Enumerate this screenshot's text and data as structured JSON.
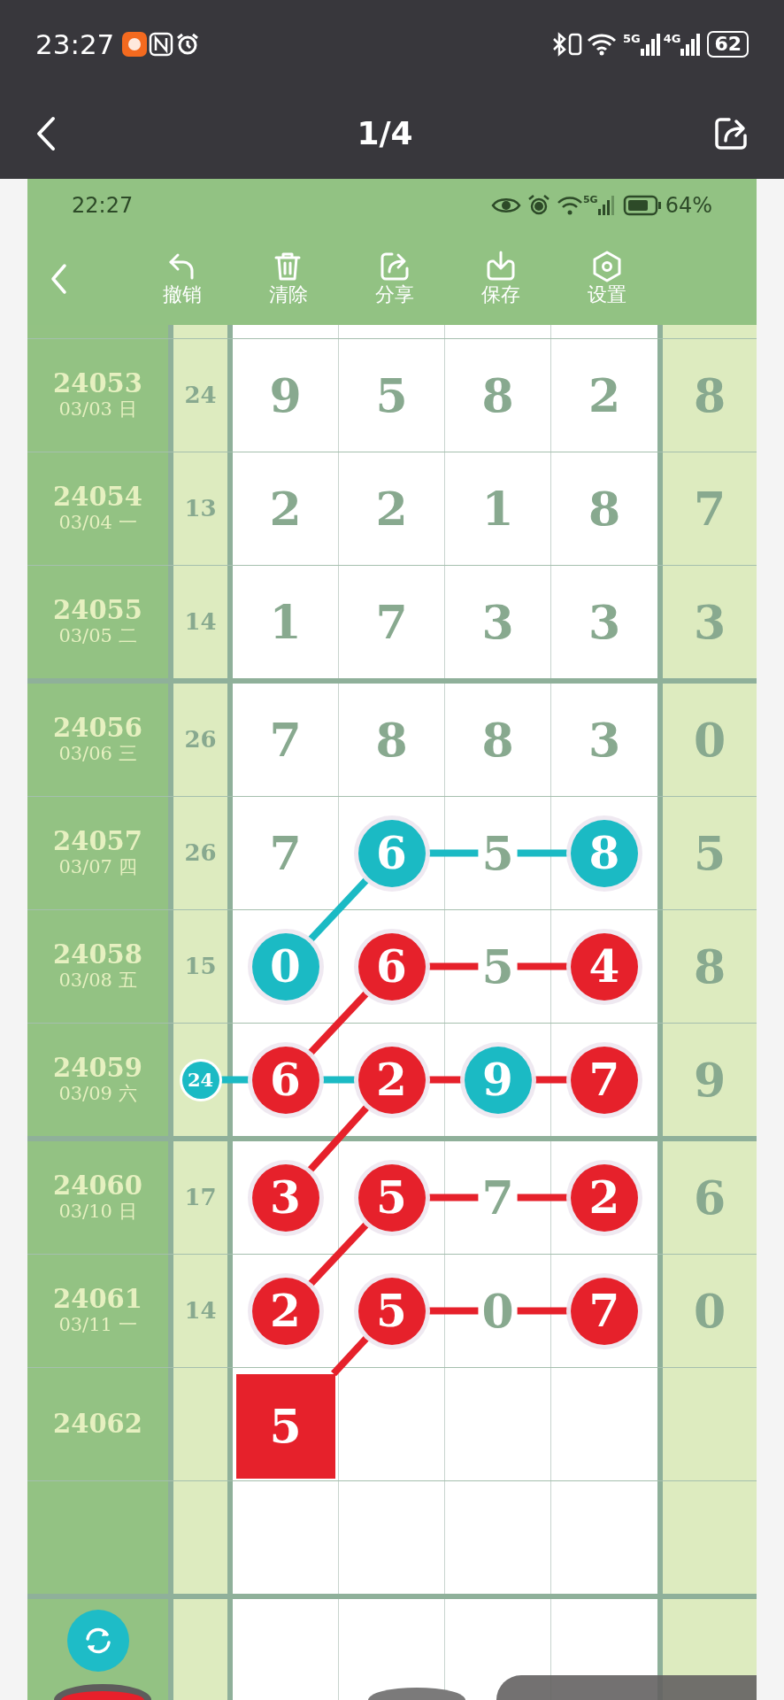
{
  "status_bar": {
    "time": "23:27",
    "network": [
      "5G",
      "4G"
    ],
    "battery": "62"
  },
  "header": {
    "title": "1/4"
  },
  "screenshot": {
    "status_bar": {
      "time": "22:27",
      "network": "5G",
      "battery": "64%"
    },
    "toolbar": [
      {
        "kind": "undo",
        "label": "撤销"
      },
      {
        "kind": "clear",
        "label": "清除"
      },
      {
        "kind": "share",
        "label": "分享"
      },
      {
        "kind": "save",
        "label": "保存"
      },
      {
        "kind": "settings",
        "label": "设置"
      }
    ],
    "groups": [
      {
        "rows": [
          {
            "issue": "24053",
            "date": "03/03 日",
            "sum": {
              "value": "24"
            },
            "cells": [
              {
                "value": "9"
              },
              {
                "value": "5"
              },
              {
                "value": "8"
              },
              {
                "value": "2"
              }
            ],
            "tail": "8"
          },
          {
            "issue": "24054",
            "date": "03/04 一",
            "sum": {
              "value": "13"
            },
            "cells": [
              {
                "value": "2"
              },
              {
                "value": "2"
              },
              {
                "value": "1"
              },
              {
                "value": "8"
              }
            ],
            "tail": "7"
          },
          {
            "issue": "24055",
            "date": "03/05 二",
            "sum": {
              "value": "14"
            },
            "cells": [
              {
                "value": "1"
              },
              {
                "value": "7"
              },
              {
                "value": "3"
              },
              {
                "value": "3"
              }
            ],
            "tail": "3"
          }
        ]
      },
      {
        "rows": [
          {
            "issue": "24056",
            "date": "03/06 三",
            "sum": {
              "value": "26"
            },
            "cells": [
              {
                "value": "7"
              },
              {
                "value": "8"
              },
              {
                "value": "8"
              },
              {
                "value": "3"
              }
            ],
            "tail": "0"
          },
          {
            "issue": "24057",
            "date": "03/07 四",
            "sum": {
              "value": "26"
            },
            "cells": [
              {
                "value": "7"
              },
              {
                "value": "6",
                "kind": "ball",
                "color": "#1bbac4",
                "link_right": {
                  "color": "#1bbac4"
                }
              },
              {
                "value": "5"
              },
              {
                "value": "8",
                "kind": "ball",
                "color": "#1bbac4"
              }
            ],
            "tail": "5"
          },
          {
            "issue": "24058",
            "date": "03/08 五",
            "sum": {
              "value": "15"
            },
            "cells": [
              {
                "value": "0",
                "kind": "ball",
                "color": "#1bbac4",
                "link_up_right": {
                  "color": "#1bbac4"
                }
              },
              {
                "value": "6",
                "kind": "ball",
                "color": "#e6212b",
                "link_right": {
                  "color": "#e6212b"
                }
              },
              {
                "value": "5"
              },
              {
                "value": "4",
                "kind": "ball",
                "color": "#e6212b"
              }
            ],
            "tail": "8"
          },
          {
            "issue": "24059",
            "date": "03/09 六",
            "sum": {
              "value": "24",
              "kind": "ball",
              "color": "#1bbac4",
              "link_right": {
                "color": "#1bbac4"
              }
            },
            "cells": [
              {
                "value": "6",
                "kind": "ball",
                "color": "#e6212b",
                "link_right": {
                  "color": "#1bbac4"
                },
                "link_up_right": {
                  "color": "#e6212b"
                }
              },
              {
                "value": "2",
                "kind": "ball",
                "color": "#e6212b",
                "link_right": {
                  "color": "#e6212b"
                }
              },
              {
                "value": "9",
                "kind": "ball",
                "color": "#1bbac4",
                "link_right": {
                  "color": "#e6212b"
                }
              },
              {
                "value": "7",
                "kind": "ball",
                "color": "#e6212b"
              }
            ],
            "tail": "9"
          }
        ]
      },
      {
        "rows": [
          {
            "issue": "24060",
            "date": "03/10 日",
            "sum": {
              "value": "17"
            },
            "cells": [
              {
                "value": "3",
                "kind": "ball",
                "color": "#e6212b",
                "link_up_right": {
                  "color": "#e6212b"
                }
              },
              {
                "value": "5",
                "kind": "ball",
                "color": "#e6212b",
                "link_right": {
                  "color": "#e6212b"
                }
              },
              {
                "value": "7"
              },
              {
                "value": "2",
                "kind": "ball",
                "color": "#e6212b"
              }
            ],
            "tail": "6"
          },
          {
            "issue": "24061",
            "date": "03/11 一",
            "sum": {
              "value": "14"
            },
            "cells": [
              {
                "value": "2",
                "kind": "ball",
                "color": "#e6212b",
                "link_up_right": {
                  "color": "#e6212b"
                }
              },
              {
                "value": "5",
                "kind": "ball",
                "color": "#e6212b",
                "link_right": {
                  "color": "#e6212b"
                }
              },
              {
                "value": "0"
              },
              {
                "value": "7",
                "kind": "ball",
                "color": "#e6212b"
              }
            ],
            "tail": "0"
          },
          {
            "issue": "24062",
            "cells": [
              {
                "value": "5",
                "kind": "square",
                "color": "#e6212b",
                "link_up_right": {
                  "color": "#e6212b"
                }
              }
            ]
          },
          {}
        ]
      }
    ]
  }
}
